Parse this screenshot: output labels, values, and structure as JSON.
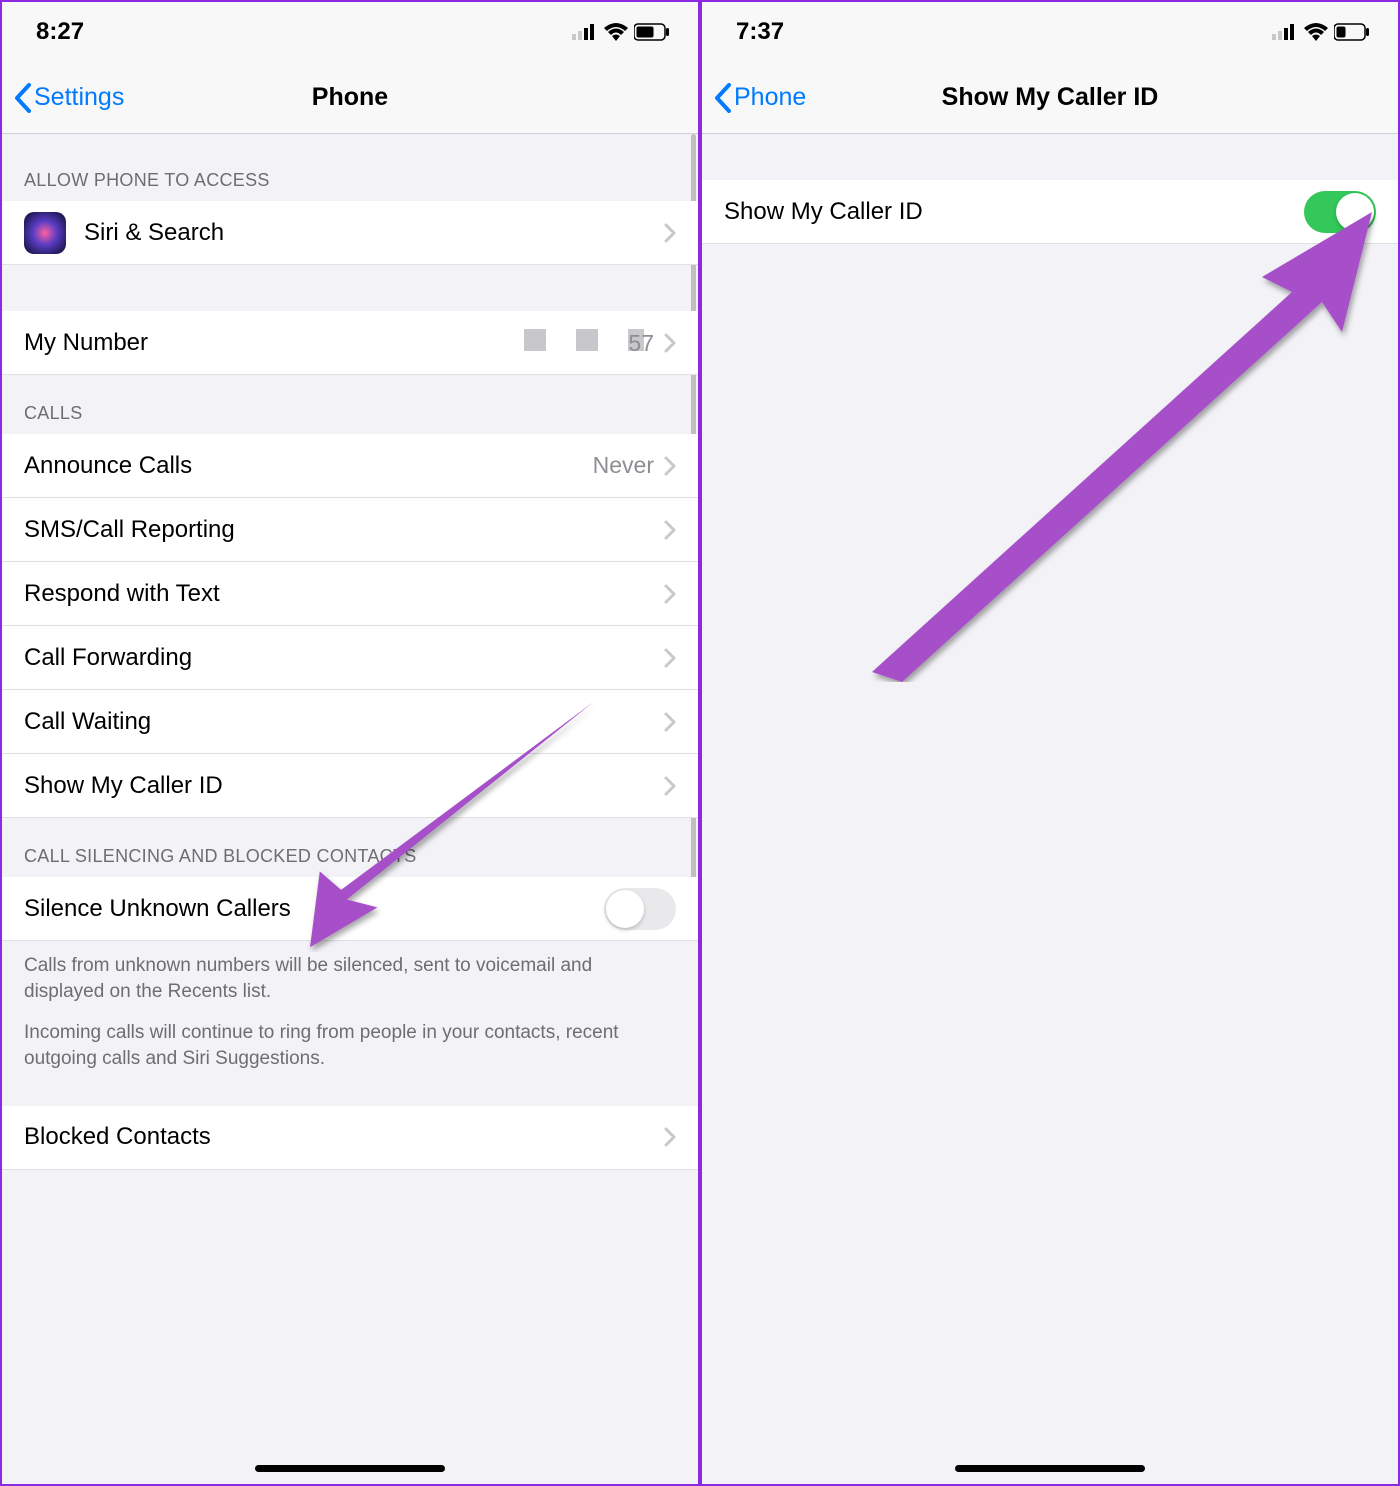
{
  "left": {
    "time": "8:27",
    "backLabel": "Settings",
    "title": "Phone",
    "section1Header": "ALLOW PHONE TO ACCESS",
    "siriRow": "Siri & Search",
    "myNumberLabel": "My Number",
    "myNumberTail": "57",
    "callsHeader": "CALLS",
    "announceLabel": "Announce Calls",
    "announceValue": "Never",
    "smsReport": "SMS/Call Reporting",
    "respondText": "Respond with Text",
    "callForwarding": "Call Forwarding",
    "callWaiting": "Call Waiting",
    "showCallerId": "Show My Caller ID",
    "silencingHeader": "CALL SILENCING AND BLOCKED CONTACTS",
    "silenceUnknown": "Silence Unknown Callers",
    "footer1": "Calls from unknown numbers will be silenced, sent to voicemail and displayed on the Recents list.",
    "footer2": "Incoming calls will continue to ring from people in your contacts, recent outgoing calls and Siri Suggestions.",
    "blockedContacts": "Blocked Contacts"
  },
  "right": {
    "time": "7:37",
    "backLabel": "Phone",
    "title": "Show My Caller ID",
    "rowLabel": "Show My Caller ID"
  }
}
